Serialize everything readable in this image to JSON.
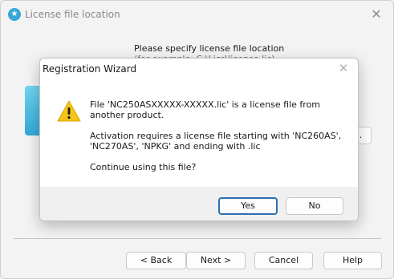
{
  "window": {
    "title": "License file location",
    "app_icon": "star-badge-icon",
    "close_glyph": "✕"
  },
  "wizard": {
    "prompt_line1": "Please specify license file location",
    "prompt_line2": "(for example: C:\\Lics\\license.lic)",
    "browse_label": "...",
    "buttons": {
      "back": "< Back",
      "next": "Next >",
      "cancel": "Cancel",
      "help": "Help"
    }
  },
  "dialog": {
    "title": "Registration Wizard",
    "close_glyph": "✕",
    "icon": "warning-icon",
    "message1": "File 'NC250ASXXXXX-XXXXX.lic' is a license file from another product.",
    "message2": "Activation requires a license file starting with 'NC260AS', 'NC270AS', 'NPKG' and ending with .lic",
    "message3": "Continue using this file?",
    "yes_label": "Yes",
    "no_label": "No"
  },
  "colors": {
    "accent": "#2f6fb1",
    "warning": "#f5c518",
    "window_bg": "#f3f3f3"
  }
}
